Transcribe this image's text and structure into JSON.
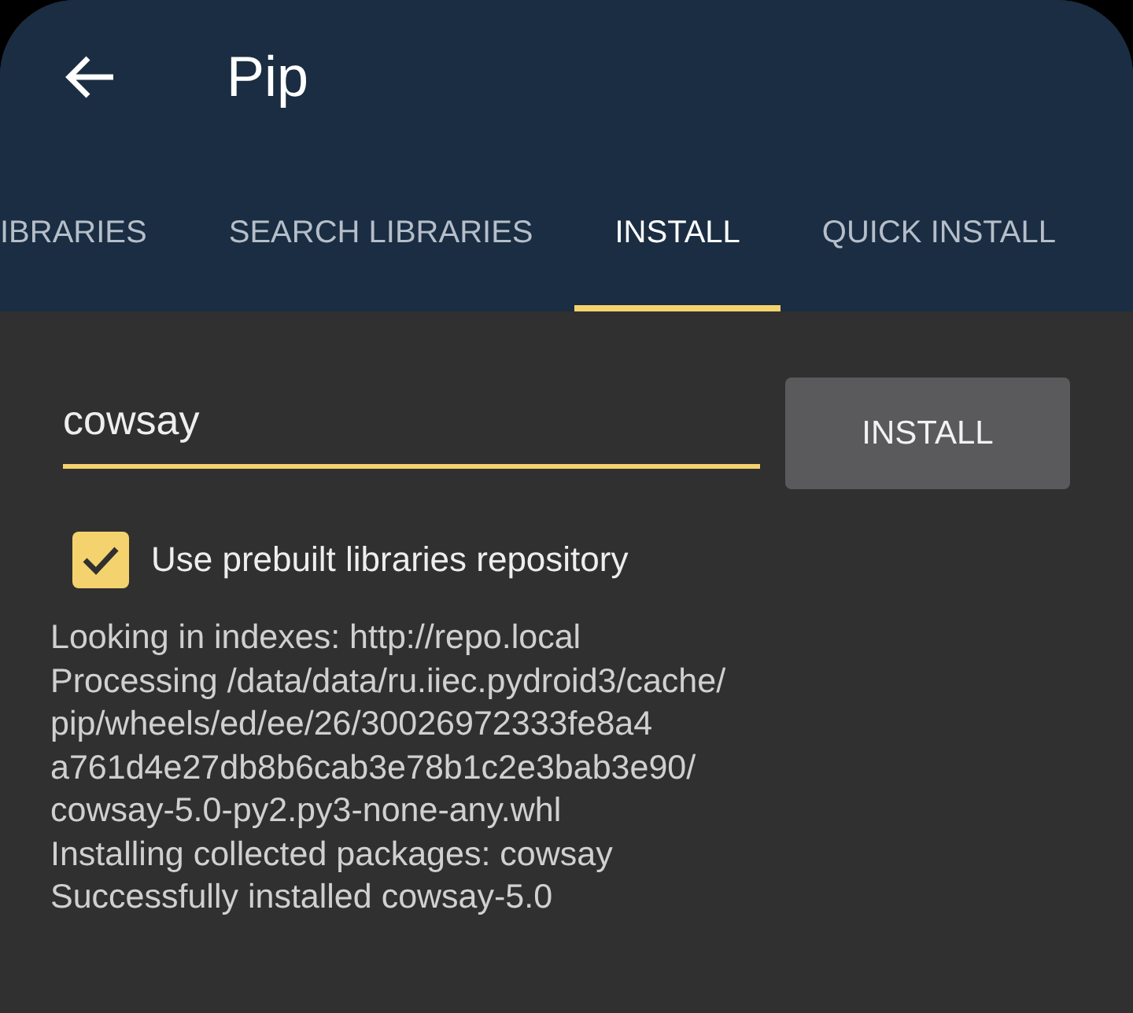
{
  "app_bar": {
    "title": "Pip"
  },
  "tabs": [
    {
      "label": "IBRARIES",
      "selected": false
    },
    {
      "label": "SEARCH LIBRARIES",
      "selected": false
    },
    {
      "label": "INSTALL",
      "selected": true
    },
    {
      "label": "QUICK INSTALL",
      "selected": false
    }
  ],
  "package_field": {
    "value": "cowsay"
  },
  "install_button": "INSTALL",
  "prebuilt_option": {
    "label": "Use prebuilt libraries repository",
    "checked": true
  },
  "log": [
    "Looking in indexes: http://repo.local",
    "Processing /data/data/ru.iiec.pydroid3/cache/",
    "pip/wheels/ed/ee/26/30026972333fe8a4",
    "a761d4e27db8b6cab3e78b1c2e3bab3e90/",
    "cowsay-5.0-py2.py3-none-any.whl",
    "Installing collected packages: cowsay",
    "Successfully installed cowsay-5.0"
  ]
}
